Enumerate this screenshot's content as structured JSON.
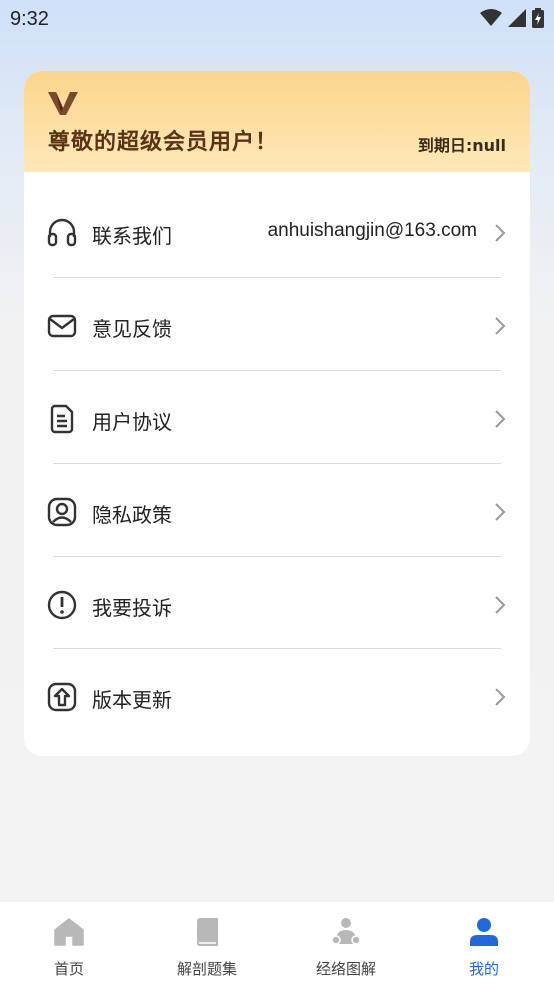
{
  "status": {
    "time": "9:32"
  },
  "vip": {
    "title": "尊敬的超级会员用户！",
    "expire": "到期日:null"
  },
  "menu": [
    {
      "id": "contact",
      "label": "联系我们",
      "value": "anhuishangjin@163.com",
      "icon": "headset-icon"
    },
    {
      "id": "feedback",
      "label": "意见反馈",
      "value": "",
      "icon": "mail-icon"
    },
    {
      "id": "agreement",
      "label": "用户协议",
      "value": "",
      "icon": "document-icon"
    },
    {
      "id": "privacy",
      "label": "隐私政策",
      "value": "",
      "icon": "user-shield-icon"
    },
    {
      "id": "complaint",
      "label": "我要投诉",
      "value": "",
      "icon": "alert-icon"
    },
    {
      "id": "update",
      "label": "版本更新",
      "value": "",
      "icon": "upgrade-icon"
    }
  ],
  "tabs": [
    {
      "id": "home",
      "label": "首页",
      "icon": "home-icon",
      "active": false
    },
    {
      "id": "questions",
      "label": "解剖题集",
      "icon": "book-icon",
      "active": false
    },
    {
      "id": "meridian",
      "label": "经络图解",
      "icon": "meridian-icon",
      "active": false
    },
    {
      "id": "mine",
      "label": "我的",
      "icon": "person-icon",
      "active": true
    }
  ],
  "colors": {
    "accent": "#2468d8",
    "vip_text": "#5a3316",
    "vip_gradient_top": "#fcd58c",
    "tab_inactive_icon": "#b8b8b8"
  }
}
